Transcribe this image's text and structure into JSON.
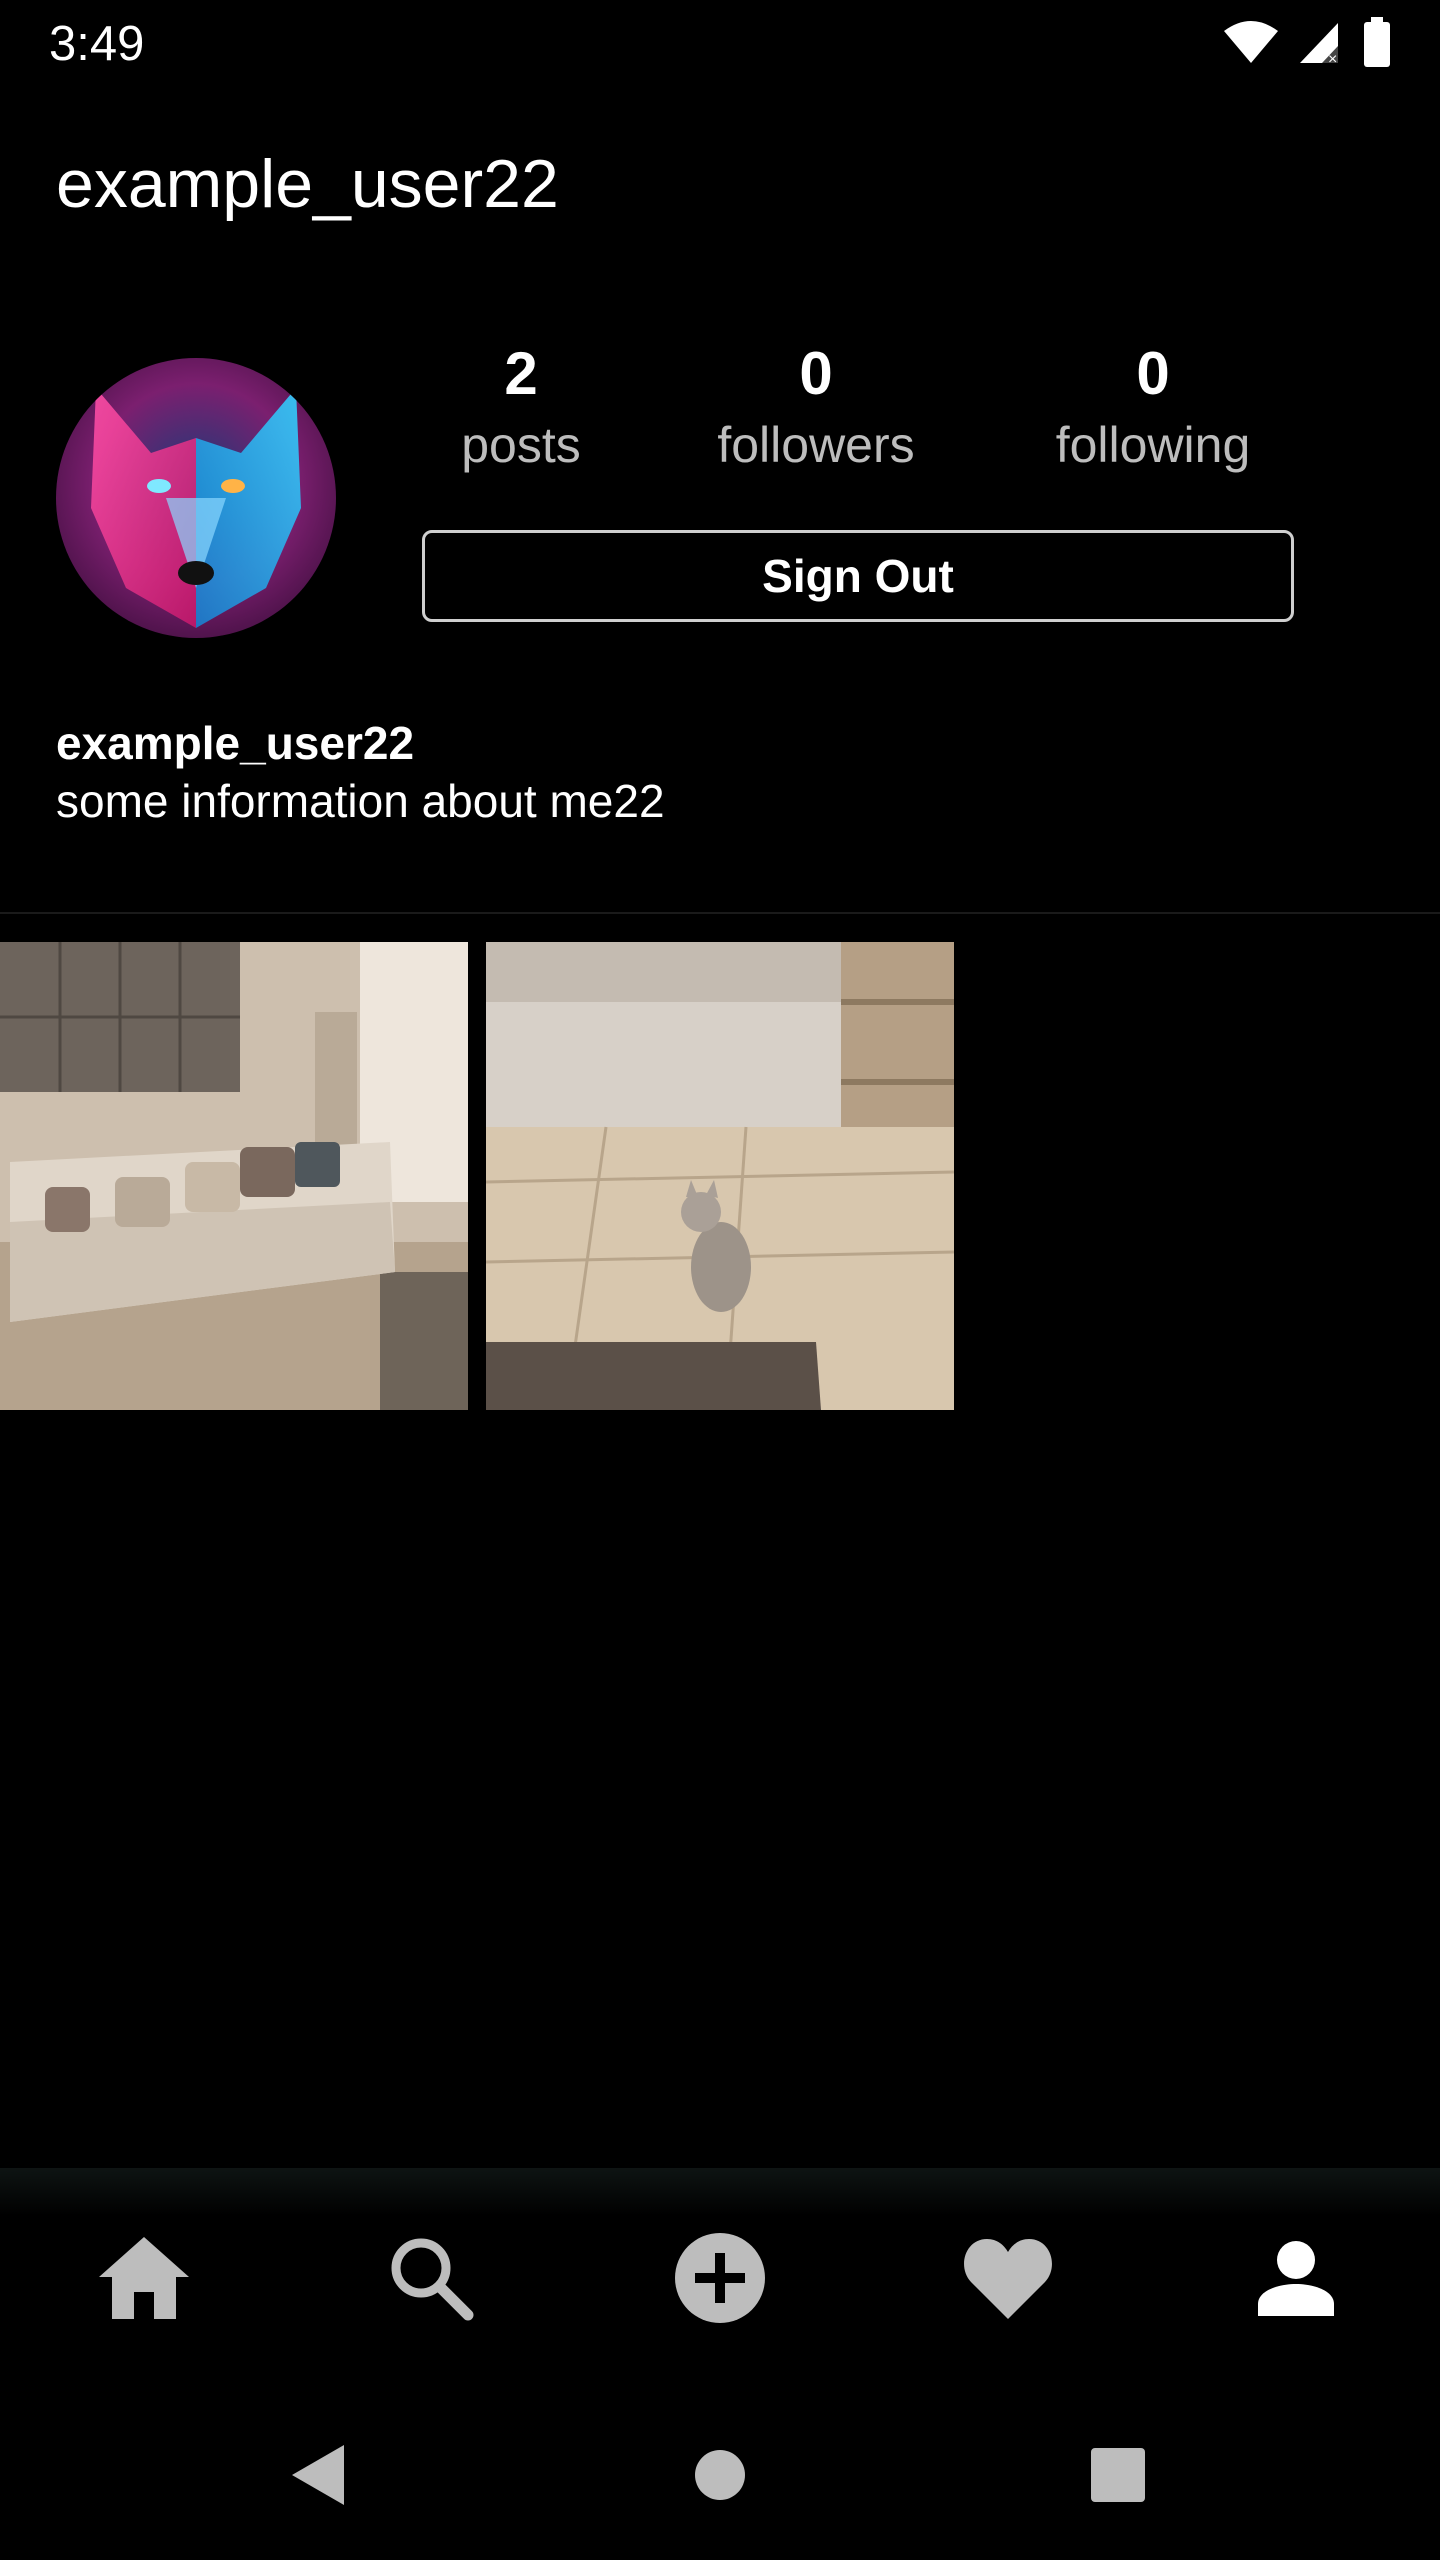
{
  "status_bar": {
    "time": "3:49",
    "icons": [
      "wifi-icon",
      "cell-signal-icon",
      "battery-icon"
    ]
  },
  "header": {
    "username": "example_user22"
  },
  "profile": {
    "avatar": "wolf-avatar",
    "stats": [
      {
        "value": "2",
        "label": "posts"
      },
      {
        "value": "0",
        "label": "followers"
      },
      {
        "value": "0",
        "label": "following"
      }
    ],
    "sign_out_label": "Sign Out",
    "bio_name": "example_user22",
    "bio_text": "some information about me22"
  },
  "posts": [
    {
      "thumbnail": "living-room-sofa-photo"
    },
    {
      "thumbnail": "cat-in-room-photo"
    }
  ],
  "bottom_nav": {
    "items": [
      "home-icon",
      "search-icon",
      "add-post-icon",
      "heart-icon",
      "profile-icon"
    ],
    "active": "profile-icon"
  },
  "system_nav": [
    "back-icon",
    "home-circle-icon",
    "recents-icon"
  ],
  "colors": {
    "background": "#000000",
    "text": "#ffffff",
    "muted_label": "#bdbdbd",
    "inactive_icon": "#bdbdbd"
  }
}
